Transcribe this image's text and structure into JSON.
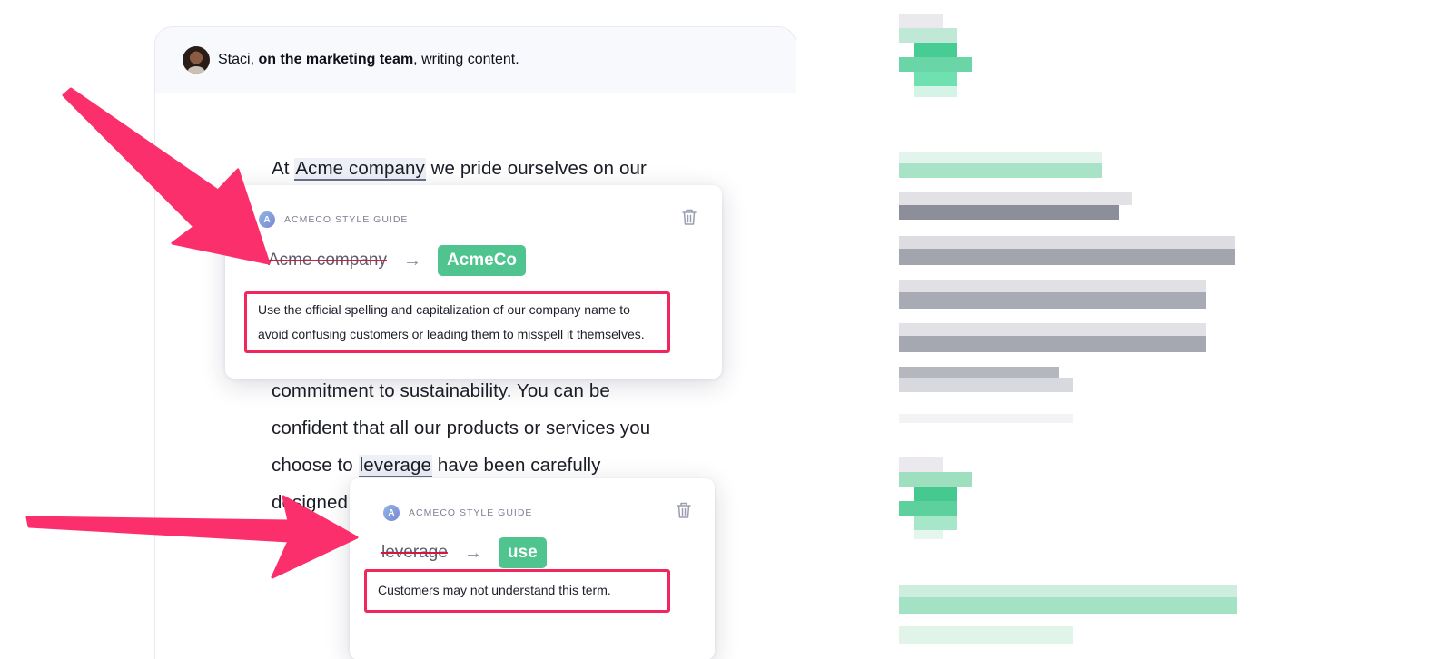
{
  "header": {
    "name": "Staci",
    "name_suffix": ", ",
    "team": "on the marketing team",
    "activity": ", writing content."
  },
  "document": {
    "line1_before": "At ",
    "line1_flag": "Acme company",
    "line1_after": " we pride ourselves on our",
    "line2": "commitment to sustainability. You can be",
    "line3": "confident that all our products or services you",
    "line4_before": "choose to ",
    "line4_flag": "leverage",
    "line4_after": " have been carefully",
    "line5_visible": "designed"
  },
  "cards": [
    {
      "source": "ACMECO STYLE GUIDE",
      "logo_letter": "A",
      "original": "Acme company",
      "replacement": "AcmeCo",
      "explanation_line1": "Use the official spelling and capitalization of our company name to",
      "explanation_line2": "avoid confusing customers or leading them to misspell it themselves."
    },
    {
      "source": "ACMECO STYLE GUIDE",
      "logo_letter": "A",
      "original": "leverage",
      "replacement": "use",
      "explanation_line1": "Customers may not understand this term."
    }
  ],
  "colors": {
    "accent_green": "#4fc48f",
    "highlight_pink": "#f0265c",
    "strike_red": "#d31a3d"
  },
  "icons": [
    "trash-icon",
    "arrow-right-icon",
    "style-guide-logo-icon"
  ]
}
